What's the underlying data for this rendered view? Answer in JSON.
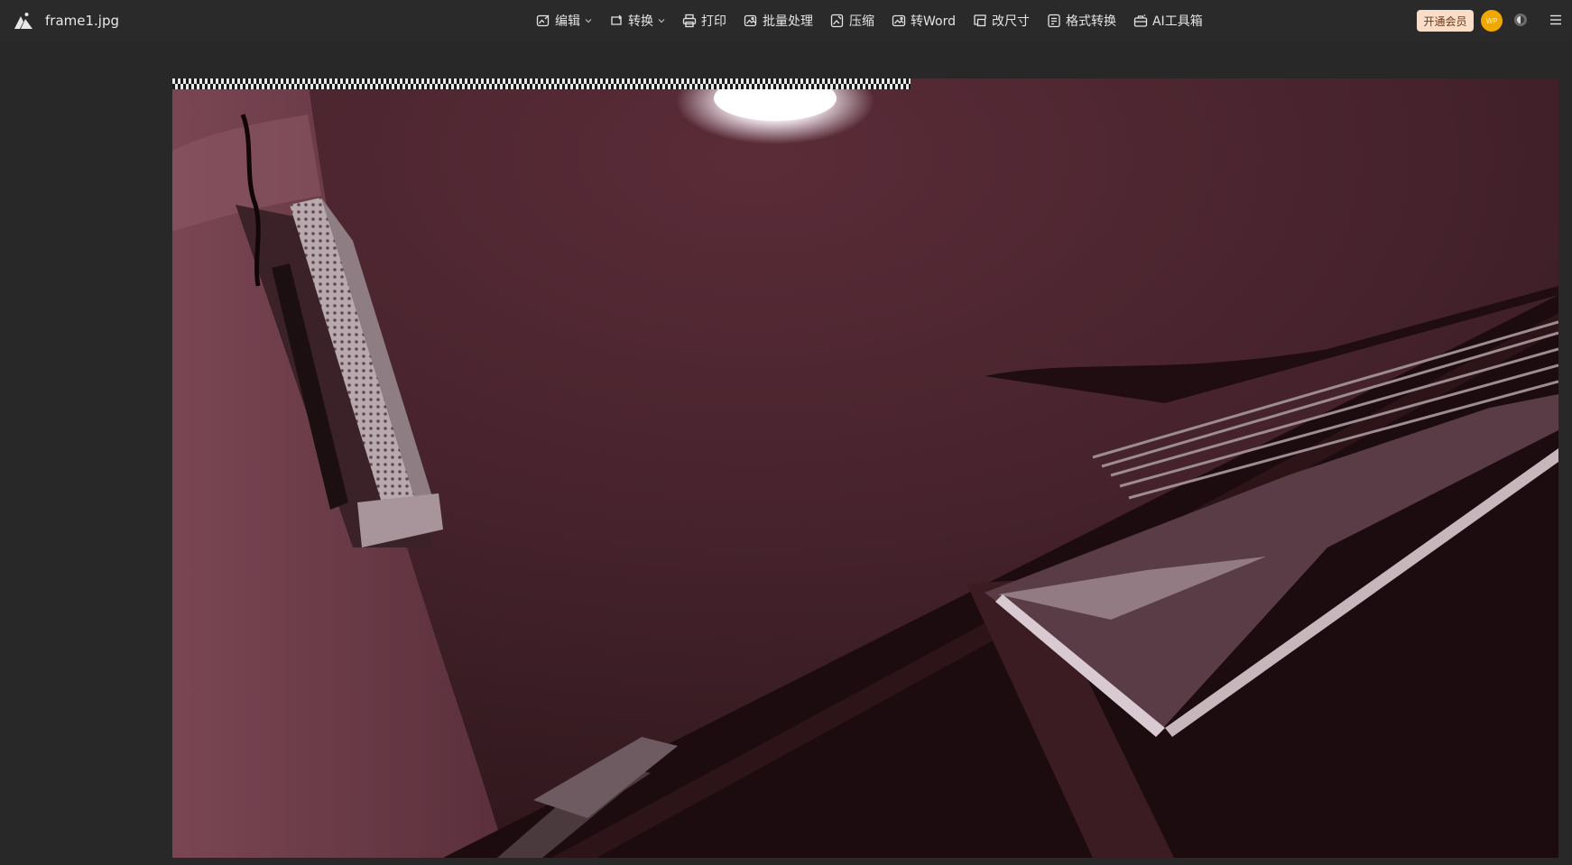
{
  "app": {
    "filename": "frame1.jpg"
  },
  "toolbar": {
    "items": [
      {
        "label": "编辑",
        "icon": "image-edit-icon",
        "has_dropdown": true
      },
      {
        "label": "转换",
        "icon": "rotate-icon",
        "has_dropdown": true
      },
      {
        "label": "打印",
        "icon": "printer-icon",
        "has_dropdown": false
      },
      {
        "label": "批量处理",
        "icon": "batch-image-icon",
        "has_dropdown": false
      },
      {
        "label": "压缩",
        "icon": "compress-icon",
        "has_dropdown": false
      },
      {
        "label": "转Word",
        "icon": "word-image-icon",
        "has_dropdown": false
      },
      {
        "label": "改尺寸",
        "icon": "resize-icon",
        "has_dropdown": false
      },
      {
        "label": "格式转换",
        "icon": "format-convert-icon",
        "has_dropdown": false
      },
      {
        "label": "AI工具箱",
        "icon": "ai-toolbox-icon",
        "has_dropdown": false
      }
    ]
  },
  "account": {
    "vip_label": "开通会员",
    "avatar_text": "WP"
  },
  "colors": {
    "background": "#282828",
    "vip_bg": "#f8ddc8",
    "avatar_bg": "#f0a800"
  }
}
